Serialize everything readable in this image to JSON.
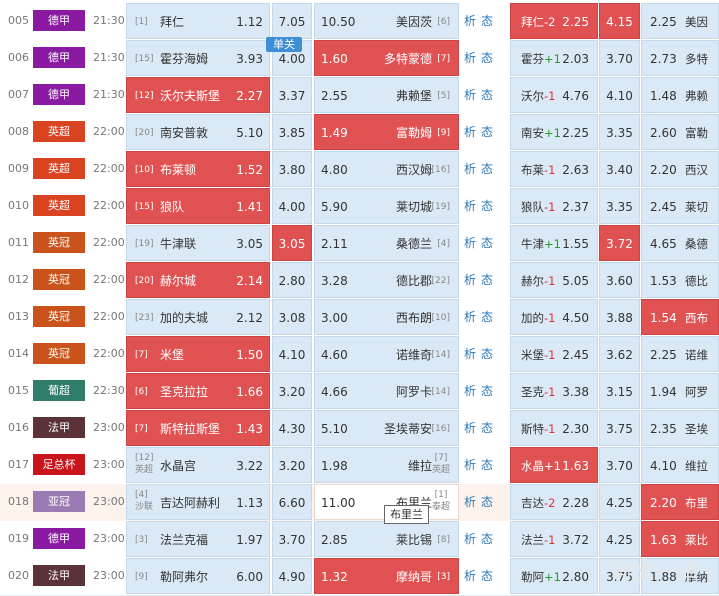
{
  "tab_label": "单关",
  "tooltip_text": "布里兰",
  "watermark": "阿文一串",
  "league_colors": {
    "德甲": "#8b1aa3",
    "英超": "#d9431f",
    "英冠": "#c9531a",
    "葡超": "#2f7d6a",
    "法甲": "#5a3238",
    "足总杯": "#c9141b",
    "亚冠": "#9a7bb3"
  },
  "matches": [
    {
      "no": "005",
      "league": "德甲",
      "time": "21:30",
      "home_rank": "[1]",
      "home": "拜仁",
      "home_odds": "1.12",
      "draw": "7.05",
      "away_odds": "10.50",
      "away": "美因茨",
      "away_rank": "[6]",
      "a1": "析",
      "a2": "态",
      "hc_team": "拜仁",
      "hc_val": "-2",
      "hc_odds": "2.25",
      "hc_draw": "4.15",
      "hc_away_odds": "2.25",
      "hc_away": "美因"
    },
    {
      "no": "006",
      "league": "德甲",
      "time": "21:30",
      "home_rank": "[15]",
      "home": "霍芬海姆",
      "home_odds": "3.93",
      "draw": "4.00",
      "away_odds": "1.60",
      "away": "多特蒙德",
      "away_rank": "[7]",
      "a1": "析",
      "a2": "态",
      "hc_team": "霍芬",
      "hc_val": "+1",
      "hc_odds": "2.03",
      "hc_draw": "3.70",
      "hc_away_odds": "2.73",
      "hc_away": "多特"
    },
    {
      "no": "007",
      "league": "德甲",
      "time": "21:30",
      "home_rank": "[12]",
      "home": "沃尔夫斯堡",
      "home_odds": "2.27",
      "draw": "3.37",
      "away_odds": "2.55",
      "away": "弗赖堡",
      "away_rank": "[5]",
      "a1": "析",
      "a2": "态",
      "hc_team": "沃尔",
      "hc_val": "-1",
      "hc_odds": "4.76",
      "hc_draw": "4.10",
      "hc_away_odds": "1.48",
      "hc_away": "弗赖"
    },
    {
      "no": "008",
      "league": "英超",
      "time": "22:00",
      "home_rank": "[20]",
      "home": "南安普敦",
      "home_odds": "5.10",
      "draw": "3.85",
      "away_odds": "1.49",
      "away": "富勒姆",
      "away_rank": "[9]",
      "a1": "析",
      "a2": "态",
      "hc_team": "南安",
      "hc_val": "+1",
      "hc_odds": "2.25",
      "hc_draw": "3.35",
      "hc_away_odds": "2.60",
      "hc_away": "富勒"
    },
    {
      "no": "009",
      "league": "英超",
      "time": "22:00",
      "home_rank": "[10]",
      "home": "布莱顿",
      "home_odds": "1.52",
      "draw": "3.80",
      "away_odds": "4.80",
      "away": "西汉姆",
      "away_rank": "[16]",
      "a1": "析",
      "a2": "态",
      "hc_team": "布莱",
      "hc_val": "-1",
      "hc_odds": "2.63",
      "hc_draw": "3.40",
      "hc_away_odds": "2.20",
      "hc_away": "西汉"
    },
    {
      "no": "010",
      "league": "英超",
      "time": "22:00",
      "home_rank": "[15]",
      "home": "狼队",
      "home_odds": "1.41",
      "draw": "4.00",
      "away_odds": "5.90",
      "away": "莱切城",
      "away_rank": "[19]",
      "a1": "析",
      "a2": "态",
      "hc_team": "狼队",
      "hc_val": "-1",
      "hc_odds": "2.37",
      "hc_draw": "3.35",
      "hc_away_odds": "2.45",
      "hc_away": "莱切"
    },
    {
      "no": "011",
      "league": "英冠",
      "time": "22:00",
      "home_rank": "[19]",
      "home": "牛津联",
      "home_odds": "3.05",
      "draw": "3.05",
      "away_odds": "2.11",
      "away": "桑德兰",
      "away_rank": "[4]",
      "a1": "析",
      "a2": "态",
      "hc_team": "牛津",
      "hc_val": "+1",
      "hc_odds": "1.55",
      "hc_draw": "3.72",
      "hc_away_odds": "4.65",
      "hc_away": "桑德"
    },
    {
      "no": "012",
      "league": "英冠",
      "time": "22:00",
      "home_rank": "[20]",
      "home": "赫尔城",
      "home_odds": "2.14",
      "draw": "2.80",
      "away_odds": "3.28",
      "away": "德比郡",
      "away_rank": "[22]",
      "a1": "析",
      "a2": "态",
      "hc_team": "赫尔",
      "hc_val": "-1",
      "hc_odds": "5.05",
      "hc_draw": "3.60",
      "hc_away_odds": "1.53",
      "hc_away": "德比"
    },
    {
      "no": "013",
      "league": "英冠",
      "time": "22:00",
      "home_rank": "[23]",
      "home": "加的夫城",
      "home_odds": "2.12",
      "draw": "3.08",
      "away_odds": "3.00",
      "away": "西布朗",
      "away_rank": "[10]",
      "a1": "析",
      "a2": "态",
      "hc_team": "加的",
      "hc_val": "-1",
      "hc_odds": "4.50",
      "hc_draw": "3.88",
      "hc_away_odds": "1.54",
      "hc_away": "西布"
    },
    {
      "no": "014",
      "league": "英冠",
      "time": "22:00",
      "home_rank": "[7]",
      "home": "米堡",
      "home_odds": "1.50",
      "draw": "4.10",
      "away_odds": "4.60",
      "away": "诺维奇",
      "away_rank": "[14]",
      "a1": "析",
      "a2": "态",
      "hc_team": "米堡",
      "hc_val": "-1",
      "hc_odds": "2.45",
      "hc_draw": "3.62",
      "hc_away_odds": "2.25",
      "hc_away": "诺维"
    },
    {
      "no": "015",
      "league": "葡超",
      "time": "22:30",
      "home_rank": "[6]",
      "home": "圣克拉拉",
      "home_odds": "1.66",
      "draw": "3.20",
      "away_odds": "4.66",
      "away": "阿罗卡",
      "away_rank": "[14]",
      "a1": "析",
      "a2": "态",
      "hc_team": "圣克",
      "hc_val": "-1",
      "hc_odds": "3.38",
      "hc_draw": "3.15",
      "hc_away_odds": "1.94",
      "hc_away": "阿罗"
    },
    {
      "no": "016",
      "league": "法甲",
      "time": "23:00",
      "home_rank": "[7]",
      "home": "斯特拉斯堡",
      "home_odds": "1.43",
      "draw": "4.30",
      "away_odds": "5.10",
      "away": "圣埃蒂安",
      "away_rank": "[16]",
      "a1": "析",
      "a2": "态",
      "hc_team": "斯特",
      "hc_val": "-1",
      "hc_odds": "2.30",
      "hc_draw": "3.75",
      "hc_away_odds": "2.35",
      "hc_away": "圣埃"
    },
    {
      "no": "017",
      "league": "足总杯",
      "time": "23:00",
      "home_rank": "[12]",
      "home_rank_sub": "英超",
      "home": "水晶宫",
      "home_odds": "3.22",
      "draw": "3.20",
      "away_odds": "1.98",
      "away": "维拉",
      "away_rank": "[7]",
      "away_rank_sub": "英超",
      "a1": "析",
      "a2": "态",
      "hc_team": "水晶",
      "hc_val": "+1",
      "hc_odds": "1.63",
      "hc_draw": "3.70",
      "hc_away_odds": "4.10",
      "hc_away": "维拉"
    },
    {
      "no": "018",
      "league": "亚冠",
      "time": "23:00",
      "home_rank": "[4]",
      "home_rank_sub": "沙联",
      "home": "吉达阿赫利",
      "home_odds": "1.13",
      "draw": "6.60",
      "away_odds": "11.00",
      "away": "布里兰",
      "away_rank": "[1]",
      "away_rank_sub": "泰超",
      "a1": "析",
      "a2": "态",
      "hc_team": "吉达",
      "hc_val": "-2",
      "hc_odds": "2.28",
      "hc_draw": "4.25",
      "hc_away_odds": "2.20",
      "hc_away": "布里"
    },
    {
      "no": "019",
      "league": "德甲",
      "time": "23:00",
      "home_rank": "[3]",
      "home": "法兰克福",
      "home_odds": "1.97",
      "draw": "3.70",
      "away_odds": "2.85",
      "away": "莱比锡",
      "away_rank": "[8]",
      "a1": "析",
      "a2": "态",
      "hc_team": "法兰",
      "hc_val": "-1",
      "hc_odds": "3.72",
      "hc_draw": "4.25",
      "hc_away_odds": "1.63",
      "hc_away": "莱比"
    },
    {
      "no": "020",
      "league": "法甲",
      "time": "23:00",
      "home_rank": "[9]",
      "home": "勒阿弗尔",
      "home_odds": "6.00",
      "draw": "4.90",
      "away_odds": "1.32",
      "away": "摩纳哥",
      "away_rank": "[3]",
      "a1": "析",
      "a2": "态",
      "hc_team": "勒阿",
      "hc_val": "+1",
      "hc_odds": "2.80",
      "hc_draw": "3.75",
      "hc_away_odds": "1.88",
      "hc_away": "摩纳"
    }
  ]
}
